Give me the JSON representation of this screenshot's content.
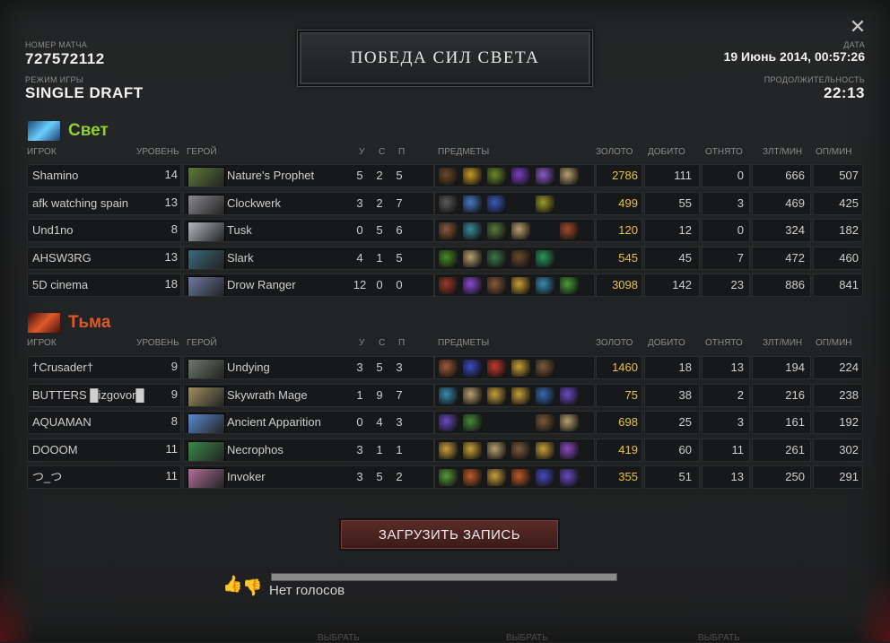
{
  "header": {
    "match_id_label": "НОМЕР МАТЧА",
    "match_id": "727572112",
    "game_mode_label": "РЕЖИМ ИГРЫ",
    "game_mode": "SINGLE DRAFT",
    "result": "ПОБЕДА СИЛ СВЕТА",
    "date_label": "ДАТА",
    "date": "19 Июнь 2014, 00:57:26",
    "duration_label": "ПРОДОЛЖИТЕЛЬНОСТЬ",
    "duration": "22:13",
    "close_icon": "✕"
  },
  "columns": {
    "player": "ИГРОК",
    "level": "УРОВЕНЬ",
    "hero": "ГЕРОЙ",
    "kills": "У",
    "deaths": "С",
    "assists": "П",
    "items": "ПРЕДМЕТЫ",
    "gold": "ЗОЛОТО",
    "last_hits": "ДОБИТО",
    "denies": "ОТНЯТО",
    "gpm": "ЗЛТ/МИН",
    "xpm": "ОП/МИН"
  },
  "radiant": {
    "name": "Свет",
    "color": "#8fd12f",
    "players": [
      {
        "player": "Shamino",
        "level": "14",
        "hero": "Nature's Prophet",
        "k": "5",
        "d": "2",
        "a": "5",
        "gold": "2786",
        "lh": "111",
        "dn": "0",
        "gpm": "666",
        "xpm": "507",
        "hero_color": "#5d7a3a",
        "items": [
          "#6b4a2a",
          "#c89a2a",
          "#6a8a2a",
          "#7b3fc4",
          "#8a5ac8",
          "#b8a070"
        ]
      },
      {
        "player": "afk watching spain",
        "level": "13",
        "hero": "Clockwerk",
        "k": "3",
        "d": "2",
        "a": "7",
        "gold": "499",
        "lh": "55",
        "dn": "3",
        "gpm": "469",
        "xpm": "425",
        "hero_color": "#8a8a90",
        "items": [
          "#5a5a5a",
          "#4a7ac8",
          "#3a5ab8",
          "",
          "#9a9a2a",
          ""
        ]
      },
      {
        "player": "Und1no",
        "level": "8",
        "hero": "Tusk",
        "k": "0",
        "d": "5",
        "a": "6",
        "gold": "120",
        "lh": "12",
        "dn": "0",
        "gpm": "324",
        "xpm": "182",
        "hero_color": "#b0b8c0",
        "items": [
          "#8a5a3a",
          "#3a8a9a",
          "#5a7a3a",
          "#b8a070",
          "",
          "#a04a2a"
        ]
      },
      {
        "player": "AHSW3RG",
        "level": "13",
        "hero": "Slark",
        "k": "4",
        "d": "1",
        "a": "5",
        "gold": "545",
        "lh": "45",
        "dn": "7",
        "gpm": "472",
        "xpm": "460",
        "hero_color": "#3a6a7a",
        "items": [
          "#4a8a2a",
          "#b8a070",
          "#3a7a4a",
          "#6a4a2a",
          "#2a9a5a",
          ""
        ]
      },
      {
        "player": "5D cinema",
        "level": "18",
        "hero": "Drow Ranger",
        "k": "12",
        "d": "0",
        "a": "0",
        "gold": "3098",
        "lh": "142",
        "dn": "23",
        "gpm": "886",
        "xpm": "841",
        "hero_color": "#6a7aa0",
        "items": [
          "#9a3a2a",
          "#8a4ad0",
          "#8a5a3a",
          "#c8a03a",
          "#3a8ab0",
          "#4a9a3a"
        ]
      }
    ]
  },
  "dire": {
    "name": "Тьма",
    "color": "#e0592a",
    "players": [
      {
        "player": "†Crusader†",
        "level": "9",
        "hero": "Undying",
        "k": "3",
        "d": "5",
        "a": "3",
        "gold": "1460",
        "lh": "18",
        "dn": "13",
        "gpm": "194",
        "xpm": "224",
        "hero_color": "#6a7a6a",
        "items": [
          "#a05a3a",
          "#3a4ac0",
          "#c03a2a",
          "#c8a03a",
          "#7a5a3a",
          ""
        ]
      },
      {
        "player": "BUTTERS █izgovor█",
        "level": "9",
        "hero": "Skywrath Mage",
        "k": "1",
        "d": "9",
        "a": "7",
        "gold": "75",
        "lh": "38",
        "dn": "2",
        "gpm": "216",
        "xpm": "238",
        "hero_color": "#a09060",
        "items": [
          "#3a8ab0",
          "#b8a070",
          "#c8a03a",
          "#c8a03a",
          "#3a6ab0",
          "#6a4ac0"
        ]
      },
      {
        "player": "AQUAMAN",
        "level": "8",
        "hero": "Ancient Apparition",
        "k": "0",
        "d": "4",
        "a": "3",
        "gold": "698",
        "lh": "25",
        "dn": "3",
        "gpm": "161",
        "xpm": "192",
        "hero_color": "#5a8ad0",
        "items": [
          "#6a4ac0",
          "#4a8a3a",
          "",
          "",
          "#7a5a3a",
          "#b8a070"
        ]
      },
      {
        "player": "DOOOM",
        "level": "11",
        "hero": "Necrophos",
        "k": "3",
        "d": "1",
        "a": "1",
        "gold": "419",
        "lh": "60",
        "dn": "11",
        "gpm": "261",
        "xpm": "302",
        "hero_color": "#3a8a4a",
        "items": [
          "#c8a03a",
          "#c8a03a",
          "#b8a070",
          "#7a5a3a",
          "#c8a03a",
          "#8a4ac0"
        ]
      },
      {
        "player": "つ_つ",
        "level": "11",
        "hero": "Invoker",
        "k": "3",
        "d": "5",
        "a": "2",
        "gold": "355",
        "lh": "51",
        "dn": "13",
        "gpm": "250",
        "xpm": "291",
        "hero_color": "#b0709a",
        "items": [
          "#5a9a3a",
          "#c05a2a",
          "#c8a03a",
          "#c05a2a",
          "#4a4ac0",
          "#6a4ac0"
        ]
      }
    ]
  },
  "footer": {
    "download_label": "ЗАГРУЗИТЬ ЗАПИСЬ",
    "votes_text": "Нет голосов",
    "thumb_up_icon": "👍",
    "thumb_down_icon": "👎",
    "bottom_tab": "ВЫБРАТЬ"
  }
}
